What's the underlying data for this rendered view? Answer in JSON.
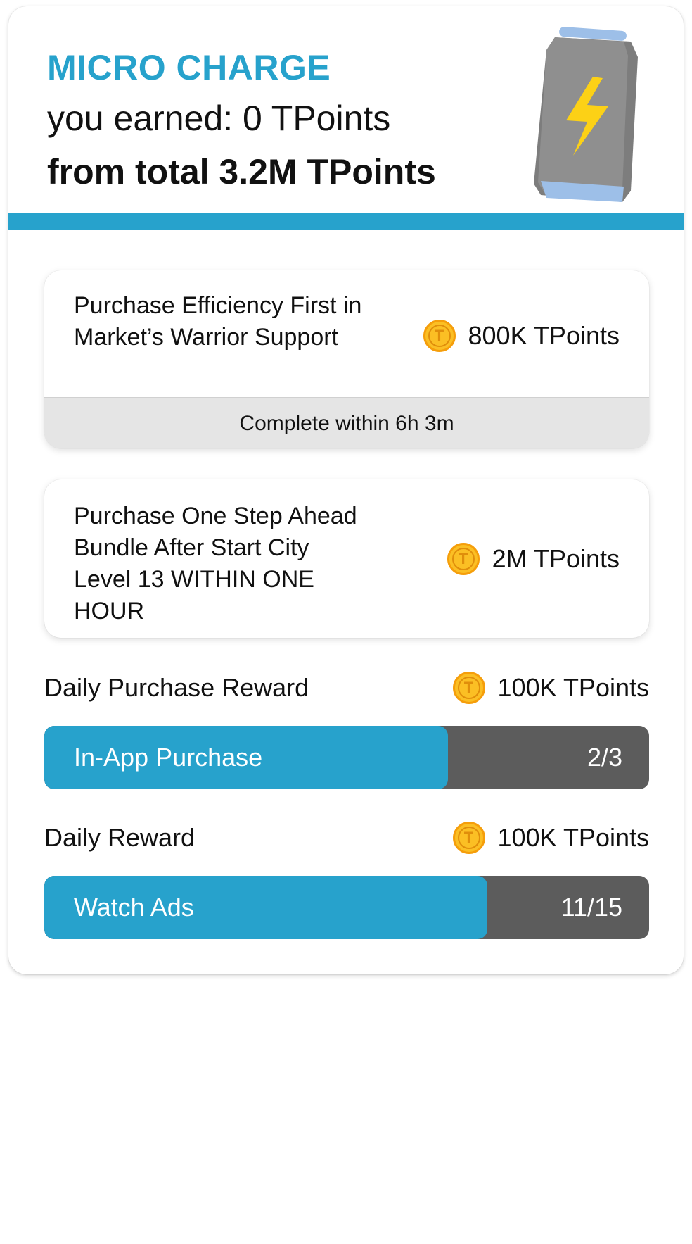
{
  "header": {
    "title": "MICRO CHARGE",
    "earned": "you earned: 0 TPoints",
    "total": "from total 3.2M TPoints"
  },
  "tasks": [
    {
      "title": "Purchase Efficiency First in Market’s Warrior Support",
      "reward": "800K TPoints",
      "timer": "Complete within 6h 3m"
    },
    {
      "title": "Purchase One Step Ahead Bundle After Start City Level 13 WITHIN ONE HOUR",
      "reward": "2M TPoints"
    }
  ],
  "daily_purchase": {
    "label": "Daily Purchase Reward",
    "reward": "100K TPoints",
    "progress_label": "In-App Purchase",
    "progress_text": "2/3",
    "progress_value": 0.667
  },
  "daily_reward": {
    "label": "Daily Reward",
    "reward": "100K TPoints",
    "progress_label": "Watch Ads",
    "progress_text": "11/15",
    "progress_value": 0.733
  },
  "icons": {
    "coin": "T",
    "energy_can": "energy-can-icon"
  },
  "colors": {
    "accent": "#27a2cc",
    "track": "#5c5c5c",
    "coin": "#fbbf24",
    "bolt": "#fcd116"
  }
}
